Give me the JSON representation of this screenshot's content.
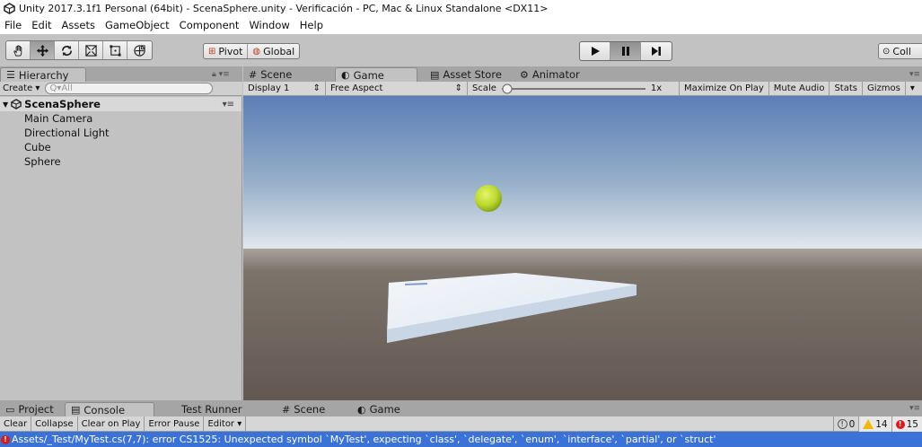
{
  "window": {
    "title": "Unity 2017.3.1f1 Personal (64bit) - ScenaSphere.unity - Verificación - PC, Mac & Linux Standalone <DX11>"
  },
  "menu": [
    "File",
    "Edit",
    "Assets",
    "GameObject",
    "Component",
    "Window",
    "Help"
  ],
  "toolbar": {
    "tools": [
      "hand-tool",
      "move-tool",
      "rotate-tool",
      "scale-tool",
      "rect-tool",
      "transform-tool"
    ],
    "active_tool": "move-tool",
    "pivot_label": "Pivot",
    "global_label": "Global",
    "collab_label": "Coll"
  },
  "hierarchy": {
    "tab_label": "Hierarchy",
    "create_label": "Create",
    "search_placeholder": "Q▾All",
    "scene_name": "ScenaSphere",
    "items": [
      "Main Camera",
      "Directional Light",
      "Cube",
      "Sphere"
    ]
  },
  "center_tabs": [
    {
      "label": "Scene",
      "icon": "#"
    },
    {
      "label": "Game",
      "icon": "◐"
    },
    {
      "label": "Asset Store",
      "icon": "▤"
    },
    {
      "label": "Animator",
      "icon": "⚙"
    }
  ],
  "active_center_tab": "Game",
  "game_bar": {
    "display": "Display 1",
    "aspect": "Free Aspect",
    "scale_label": "Scale",
    "scale_value": "1x",
    "maximize": "Maximize On Play",
    "mute": "Mute Audio",
    "stats": "Stats",
    "gizmos": "Gizmos"
  },
  "bottom_tabs": [
    {
      "label": "Project",
      "icon": "▭"
    },
    {
      "label": "Console",
      "icon": "▤"
    },
    {
      "label": "Test Runner",
      "icon": ""
    },
    {
      "label": "Scene",
      "icon": "#"
    },
    {
      "label": "Game",
      "icon": "◐"
    }
  ],
  "active_bottom_tab": "Console",
  "console": {
    "buttons": [
      "Clear",
      "Collapse",
      "Clear on Play",
      "Error Pause",
      "Editor"
    ],
    "info_count": "0",
    "warning_count": "14",
    "error_count": "15",
    "error_message": "Assets/_Test/MyTest.cs(7,7): error CS1525: Unexpected symbol `MyTest', expecting `class', `delegate', `enum', `interface', `partial', or `struct'"
  },
  "colors": {
    "editor_bg": "#c2c2c2",
    "error_bar": "#3a72d8",
    "sphere": "#b9d82e",
    "sky_top": "#5b7eb7",
    "ground": "#6b615a"
  }
}
